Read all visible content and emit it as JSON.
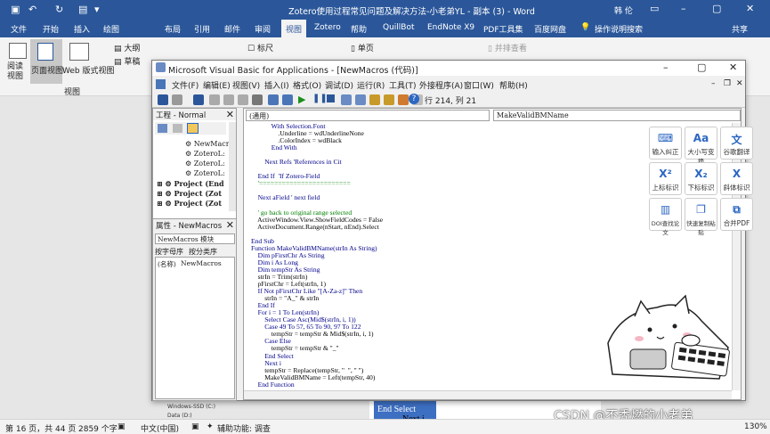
{
  "word": {
    "title": "Zotero使用过程常见问题及解决方法-小老弟YL - 副本 (3) - Word",
    "user": "韩 伦",
    "share": "共享",
    "tabs": [
      "文件",
      "开始",
      "插入",
      "绘图",
      "布局",
      "引用",
      "邮件",
      "审阅",
      "视图",
      "Zotero",
      "帮助",
      "QuillBot",
      "EndNote X9",
      "PDF工具集",
      "百度网盘",
      "操作说明搜索"
    ],
    "active_tab": "视图",
    "ribbon": {
      "read_view": "阅读视图",
      "page_view": "页面视图",
      "web_view": "Web 版式视图",
      "outline": "大纲",
      "draft": "草稿",
      "ruler": "标尺",
      "single_page": "单页",
      "parallel": "并排查看",
      "group_label": "视图"
    },
    "doc_fragments": [
      "End Select",
      "Next i"
    ],
    "status": {
      "page": "第 16 页，共 44 页",
      "words": "2859 个字",
      "lang": "中文(中国)",
      "accessibility": "辅助功能: 调查",
      "zoom": "130%"
    },
    "nav_items": [
      "Windows-SSD (C:)",
      "Data (D:)"
    ]
  },
  "vba": {
    "title": "Microsoft Visual Basic for Applications - [NewMacros (代码)]",
    "menu": [
      "文件(F)",
      "编辑(E)",
      "视图(V)",
      "插入(I)",
      "格式(O)",
      "调试(D)",
      "运行(R)",
      "工具(T)",
      "外接程序(A)",
      "窗口(W)",
      "帮助(H)"
    ],
    "position": "行 214, 列 21",
    "project_header": "工程 - Normal",
    "tree": [
      "NewMacro",
      "ZoteroL:",
      "ZoteroL:",
      "ZoteroL:",
      "Project (End",
      "Project (Zot",
      "Project (Zot"
    ],
    "props_header": "属性 - NewMacros",
    "props_combo": "NewMacros 模块",
    "props_tabs": [
      "按字母序",
      "按分类序"
    ],
    "prop_row": {
      "name": "(名称)",
      "value": "NewMacros"
    },
    "combo_left": "(通用)",
    "combo_right": "MakeValidBMName",
    "code_lines": [
      {
        "t": "            With Selection.Font",
        "c": "kw"
      },
      {
        "t": "                .Underline = wdUnderlineNone",
        "c": ""
      },
      {
        "t": "                .ColorIndex = wdBlack",
        "c": ""
      },
      {
        "t": "            End With",
        "c": "kw"
      },
      {
        "t": "",
        "c": ""
      },
      {
        "t": "        Next Refs 'References in Cit",
        "c": "kw"
      },
      {
        "t": "",
        "c": ""
      },
      {
        "t": "    End If  'If Zotero-Field",
        "c": "kw"
      },
      {
        "t": "    '========================",
        "c": "cm"
      },
      {
        "t": "",
        "c": ""
      },
      {
        "t": "    Next aField ' next field",
        "c": "kw"
      },
      {
        "t": "",
        "c": ""
      },
      {
        "t": "    ' go back to original range selected",
        "c": "cm"
      },
      {
        "t": "    ActiveWindow.View.ShowFieldCodes = False",
        "c": ""
      },
      {
        "t": "    ActiveDocument.Range(nStart, nEnd).Select",
        "c": ""
      },
      {
        "t": "",
        "c": ""
      },
      {
        "t": "End Sub",
        "c": "kw"
      },
      {
        "t": "Function MakeValidBMName(strIn As String)",
        "c": "kw"
      },
      {
        "t": "    Dim pFirstChr As String",
        "c": "kw"
      },
      {
        "t": "    Dim i As Long",
        "c": "kw"
      },
      {
        "t": "    Dim tempStr As String",
        "c": "kw"
      },
      {
        "t": "    strIn = Trim(strIn)",
        "c": ""
      },
      {
        "t": "    pFirstChr = Left(strIn, 1)",
        "c": ""
      },
      {
        "t": "    If Not pFirstChr Like \"[A-Za-z]\" Then",
        "c": "kw"
      },
      {
        "t": "        strIn = \"A_\" & strIn",
        "c": ""
      },
      {
        "t": "    End If",
        "c": "kw"
      },
      {
        "t": "    For i = 1 To Len(strIn)",
        "c": "kw"
      },
      {
        "t": "        Select Case Asc(Mid$(strIn, i, 1))",
        "c": "kw"
      },
      {
        "t": "        Case 49 To 57, 65 To 90, 97 To 122",
        "c": "kw"
      },
      {
        "t": "            tempStr = tempStr & Mid$(strIn, i, 1)",
        "c": ""
      },
      {
        "t": "        Case Else",
        "c": "kw"
      },
      {
        "t": "            tempStr = tempStr & \"_\"",
        "c": ""
      },
      {
        "t": "        End Select",
        "c": "kw"
      },
      {
        "t": "        Next i",
        "c": "kw"
      },
      {
        "t": "        tempStr = Replace(tempStr, \"  \", \" \")",
        "c": ""
      },
      {
        "t": "        MakeValidBMName = Left(tempStr, 40)",
        "c": ""
      },
      {
        "t": "    End Function",
        "c": "kw"
      }
    ]
  },
  "tools": [
    {
      "label": "输入纠正",
      "icon": "keyboard-icon"
    },
    {
      "label": "大小写变换",
      "icon": "case-icon"
    },
    {
      "label": "谷歌翻译",
      "icon": "translate-icon"
    },
    {
      "label": "上标标识",
      "icon": "superscript-icon"
    },
    {
      "label": "下标标识",
      "icon": "subscript-icon"
    },
    {
      "label": "斜体标识",
      "icon": "italic-icon"
    },
    {
      "label": "DOI查找论文",
      "icon": "doi-icon"
    },
    {
      "label": "快速复制粘贴",
      "icon": "copy-icon"
    },
    {
      "label": "合并PDF",
      "icon": "pdf-icon"
    }
  ],
  "watermark": "CSDN @不秃燃的小老弟"
}
